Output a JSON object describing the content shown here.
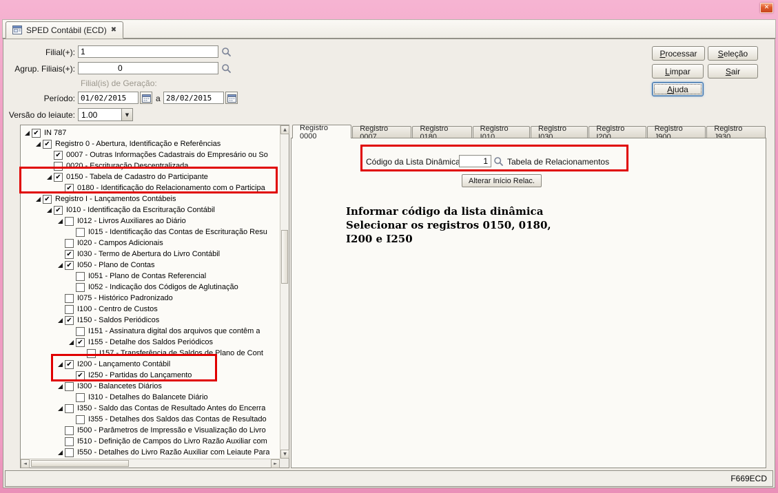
{
  "window": {
    "doc_tab_title": "SPED Contábil (ECD)",
    "status_code": "F669ECD"
  },
  "icons": {
    "close_glyph": "✕",
    "tab_close_glyph": "✖",
    "check_glyph": "✔",
    "dropdown_glyph": "▼",
    "scroll_up_glyph": "▲",
    "scroll_down_glyph": "▼",
    "scroll_left_glyph": "◄",
    "scroll_right_glyph": "►"
  },
  "form": {
    "filial_label": "Filial(+):",
    "filial_value": "1",
    "agrup_label": "Agrup. Filiais(+):",
    "agrup_value": "0",
    "geracao_label": "Filial(is) de Geração:",
    "periodo_label": "Período:",
    "periodo_from": "01/02/2015",
    "periodo_sep": "a",
    "periodo_to": "28/02/2015",
    "versao_label": "Versão do leiaute:",
    "versao_value": "1.00"
  },
  "actions": {
    "processar": "Processar",
    "selecao": "Seleção",
    "limpar": "Limpar",
    "sair": "Sair",
    "ajuda": "Ajuda"
  },
  "register_tabs": {
    "active": 0,
    "items": [
      "Registro 0000",
      "Registro 0007",
      "Registro 0180",
      "Registro I010",
      "Registro I030",
      "Registro I200",
      "Registro J900",
      "Registro J930"
    ]
  },
  "panel": {
    "codigo_label": "Código da Lista Dinâmica:",
    "codigo_value": "1",
    "codigo_desc": "Tabela de Relacionamentos",
    "alterar_button": "Alterar Início Relac.",
    "note_lines": [
      "Informar código da lista dinâmica",
      "Selecionar os registros 0150, 0180,",
      "I200 e I250"
    ]
  },
  "annotation_color": "#e00000",
  "tree": {
    "items": [
      {
        "level": 0,
        "arrow": true,
        "checked": true,
        "label": "IN 787"
      },
      {
        "level": 1,
        "arrow": true,
        "checked": true,
        "label": "Registro 0 - Abertura, Identificação e Referências"
      },
      {
        "level": 2,
        "arrow": false,
        "checked": true,
        "label": "0007 - Outras Informações Cadastrais do Empresário ou So"
      },
      {
        "level": 2,
        "arrow": false,
        "checked": false,
        "label": "0020 - Escrituração Descentralizada"
      },
      {
        "level": 2,
        "arrow": true,
        "checked": true,
        "label": "0150 - Tabela de Cadastro do Participante"
      },
      {
        "level": 3,
        "arrow": false,
        "checked": true,
        "label": "0180 - Identificação do Relacionamento com o Participa"
      },
      {
        "level": 1,
        "arrow": true,
        "checked": true,
        "label": "Registro I - Lançamentos Contábeis"
      },
      {
        "level": 2,
        "arrow": true,
        "checked": true,
        "label": "I010 - Identificação da Escrituração Contábil"
      },
      {
        "level": 3,
        "arrow": true,
        "checked": false,
        "label": "I012 - Livros Auxiliares ao Diário"
      },
      {
        "level": 4,
        "arrow": false,
        "checked": false,
        "label": "I015 - Identificação das Contas de Escrituração Resu"
      },
      {
        "level": 3,
        "arrow": false,
        "checked": false,
        "label": "I020 - Campos Adicionais"
      },
      {
        "level": 3,
        "arrow": false,
        "checked": true,
        "label": "I030 - Termo de Abertura do Livro Contábil"
      },
      {
        "level": 3,
        "arrow": true,
        "checked": true,
        "label": "I050 - Plano de Contas"
      },
      {
        "level": 4,
        "arrow": false,
        "checked": false,
        "label": "I051 - Plano de Contas Referencial"
      },
      {
        "level": 4,
        "arrow": false,
        "checked": false,
        "label": "I052 - Indicação dos Códigos de Aglutinação"
      },
      {
        "level": 3,
        "arrow": false,
        "checked": false,
        "label": "I075 - Histórico Padronizado"
      },
      {
        "level": 3,
        "arrow": false,
        "checked": false,
        "label": "I100 - Centro de Custos"
      },
      {
        "level": 3,
        "arrow": true,
        "checked": true,
        "label": "I150 - Saldos Periódicos"
      },
      {
        "level": 4,
        "arrow": false,
        "checked": false,
        "label": "I151 - Assinatura digital dos arquivos que contêm a"
      },
      {
        "level": 4,
        "arrow": true,
        "checked": true,
        "label": "I155 - Detalhe dos Saldos Periódicos"
      },
      {
        "level": 5,
        "arrow": false,
        "checked": false,
        "label": "I157 - Transferência de Saldos de Plano de Cont"
      },
      {
        "level": 3,
        "arrow": true,
        "checked": true,
        "label": "I200 - Lançamento Contábil"
      },
      {
        "level": 4,
        "arrow": false,
        "checked": true,
        "label": "I250 - Partidas do Lançamento"
      },
      {
        "level": 3,
        "arrow": true,
        "checked": false,
        "label": "I300 - Balancetes Diários"
      },
      {
        "level": 4,
        "arrow": false,
        "checked": false,
        "label": "I310 - Detalhes do Balancete Diário"
      },
      {
        "level": 3,
        "arrow": true,
        "checked": false,
        "label": "I350 - Saldo das Contas de Resultado Antes do Encerra"
      },
      {
        "level": 4,
        "arrow": false,
        "checked": false,
        "label": "I355 - Detalhes dos Saldos das Contas de Resultado"
      },
      {
        "level": 3,
        "arrow": false,
        "checked": false,
        "label": "I500 - Parâmetros de Impressão e Visualização do Livro"
      },
      {
        "level": 3,
        "arrow": false,
        "checked": false,
        "label": "I510 - Definição de Campos do Livro Razão Auxiliar com"
      },
      {
        "level": 3,
        "arrow": true,
        "checked": false,
        "label": "I550 - Detalhes do Livro Razão Auxiliar com Leiaute Para"
      }
    ]
  }
}
